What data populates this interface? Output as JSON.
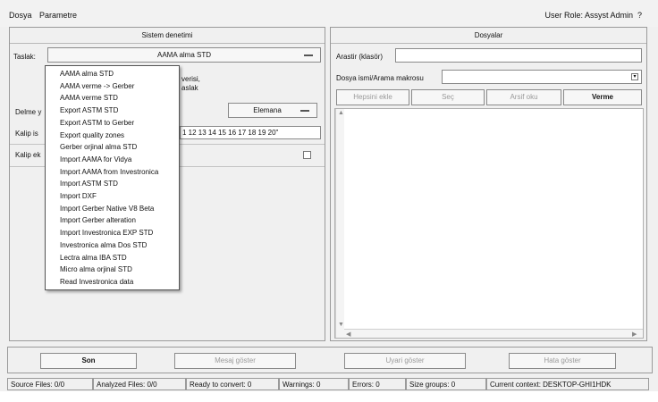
{
  "menubar": {
    "items": [
      "Dosya",
      "Parametre"
    ],
    "user_role": "User Role: Assyst Admin",
    "help": "?"
  },
  "left_panel": {
    "title": "Sistem denetimi",
    "taslak_label": "Taslak:",
    "taslak_value": "AAMA alma STD",
    "hidden_text_line1": "verisi,",
    "hidden_text_line2": "aslak",
    "delme_label": "Delme y",
    "elemana_value": "Elemana",
    "kalip_label": "Kalip is",
    "kalip_value": "1 12 13 14 15 16 17 18 19 20\"",
    "kalip_ek_label": "Kalip ek"
  },
  "dropdown": {
    "items": [
      "AAMA alma STD",
      "AAMA verme -> Gerber",
      "AAMA verme  STD",
      "Export ASTM STD",
      "Export ASTM to Gerber",
      "Export quality zones",
      "Gerber orjinal alma STD",
      "Import AAMA for Vidya",
      "Import AAMA from Investronica",
      "Import ASTM STD",
      "Import DXF",
      "Import Gerber Native V8 Beta",
      "Import Gerber alteration",
      "Import Investronica EXP STD",
      "Investronica alma Dos STD",
      "Lectra alma IBA STD",
      "Micro alma orjinal STD",
      "Read Investronica data"
    ]
  },
  "right_panel": {
    "title": "Dosyalar",
    "arastir_label": "Arastir (klasör)",
    "dosya_label": "Dosya ismi/Arama makrosu",
    "buttons": {
      "hepsini": "Hepsini ekle",
      "sec": "Seç",
      "arsif": "Arsif oku",
      "verme": "Verme"
    }
  },
  "bottom_buttons": {
    "son": "Son",
    "mesaj": "Mesaj göster",
    "uyari": "Uyari göster",
    "hata": "Hata göster"
  },
  "statusbar": {
    "source": "Source Files: 0/0",
    "analyzed": "Analyzed Files: 0/0",
    "ready": "Ready to convert: 0",
    "warnings": "Warnings: 0",
    "errors": "Errors: 0",
    "size_groups": "Size groups: 0",
    "context": "Current context: DESKTOP-GHI1HDK"
  },
  "colors": {
    "window_bg": "#f0f0f0",
    "border": "#9a9a9a",
    "disabled_text": "#9a9a9a"
  }
}
